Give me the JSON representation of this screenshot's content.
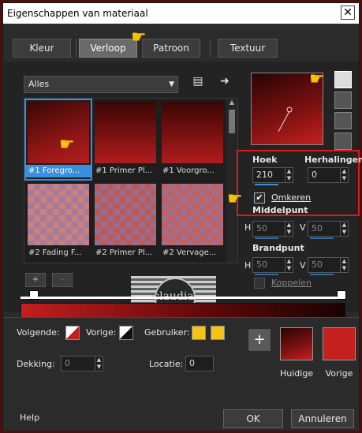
{
  "window": {
    "title": "Eigenschappen van materiaal"
  },
  "tabs": [
    {
      "label": "Kleur",
      "active": false
    },
    {
      "label": "Verloop",
      "active": true
    },
    {
      "label": "Patroon",
      "active": false
    },
    {
      "label": "Textuur",
      "active": false
    }
  ],
  "gallery": {
    "dropdown_value": "Alles",
    "items": [
      {
        "caption": "#1 Foregro...",
        "selected": true
      },
      {
        "caption": "#1 Primer Pl...",
        "selected": false
      },
      {
        "caption": "#1 Voorgro...",
        "selected": false
      },
      {
        "caption": "#2 Fading F...",
        "selected": false
      },
      {
        "caption": "#2 Primer Pl...",
        "selected": false
      },
      {
        "caption": "#2 Vervage...",
        "selected": false
      }
    ],
    "add_label": "+",
    "remove_label": "-"
  },
  "settings": {
    "angle_label": "Hoek",
    "angle_value": "210",
    "repeats_label": "Herhalingen",
    "repeats_value": "0",
    "invert_label": "Omkeren",
    "invert_checked": true,
    "center_label": "Middelpunt",
    "center_h_label": "H",
    "center_h_value": "50",
    "center_v_label": "V",
    "center_v_value": "50",
    "focal_label": "Brandpunt",
    "focal_h_label": "H",
    "focal_h_value": "50",
    "focal_v_label": "V",
    "focal_v_value": "50",
    "link_label": "Koppelen",
    "link_checked": false
  },
  "watermark": {
    "text": "claudia"
  },
  "bottom": {
    "next_label": "Volgende:",
    "prev_label": "Vorige:",
    "user_label": "Gebruiker:",
    "opacity_label": "Dekking:",
    "opacity_value": "0",
    "location_label": "Locatie:",
    "location_value": "0",
    "plus_label": "+",
    "current_label": "Huidige",
    "previous_label": "Vorige"
  },
  "footer": {
    "help": "Help",
    "ok": "OK",
    "cancel": "Annuleren"
  },
  "colors": {
    "user_swatch_1": "#f2c318",
    "user_swatch_2": "#f2c318",
    "previous_swatch": "#c42020",
    "accent": "#3a8fe0",
    "highlight": "#e01818"
  }
}
